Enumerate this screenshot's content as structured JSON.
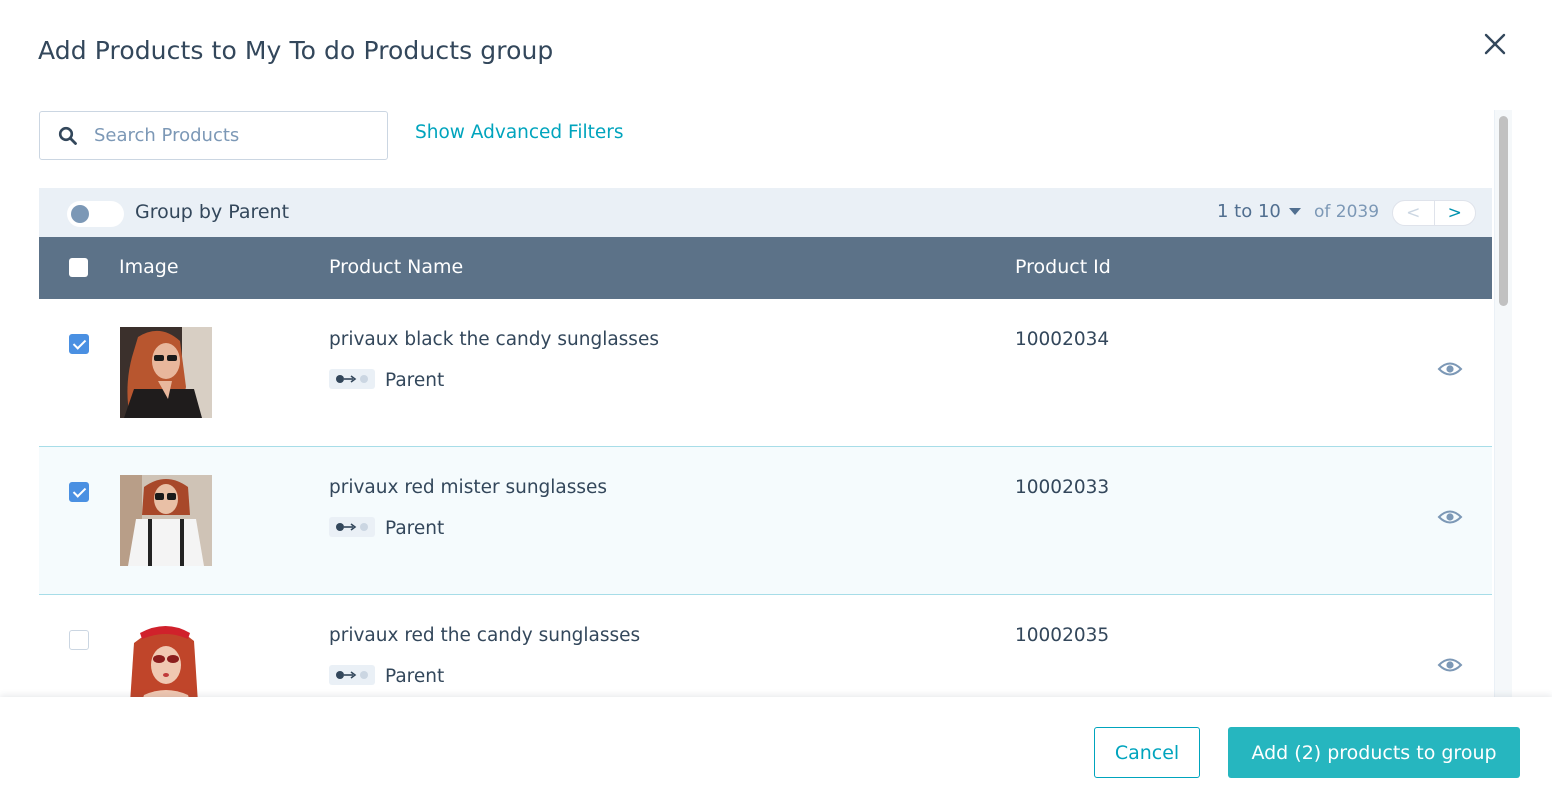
{
  "modal": {
    "title": "Add Products to My To do Products group",
    "close_icon": "close-icon"
  },
  "search": {
    "placeholder": "Search Products",
    "value": "",
    "icon": "search-icon"
  },
  "filters": {
    "advanced_label": "Show Advanced Filters"
  },
  "toolbar": {
    "group_by_label": "Group by Parent",
    "group_by_enabled": false,
    "pager": {
      "range": "1 to 10",
      "of": "of 2039",
      "prev": "<",
      "next": ">"
    }
  },
  "table": {
    "columns": [
      "Image",
      "Product Name",
      "Product Id"
    ],
    "rows": [
      {
        "checked": true,
        "name": "privaux black the candy sunglasses",
        "type": "Parent",
        "id": "10002034",
        "selected": false
      },
      {
        "checked": true,
        "name": "privaux red mister sunglasses",
        "type": "Parent",
        "id": "10002033",
        "selected": true
      },
      {
        "checked": false,
        "name": "privaux red the candy sunglasses",
        "type": "Parent",
        "id": "10002035",
        "selected": false
      }
    ]
  },
  "footer": {
    "cancel_label": "Cancel",
    "add_label": "Add (2) products to group"
  },
  "colors": {
    "accent": "#00a4bd",
    "primary_button": "#26b6bf",
    "header_bg": "#5c7288",
    "toolbar_bg": "#eaf0f6",
    "checkbox_checked": "#4a90e2",
    "text": "#33475b"
  }
}
